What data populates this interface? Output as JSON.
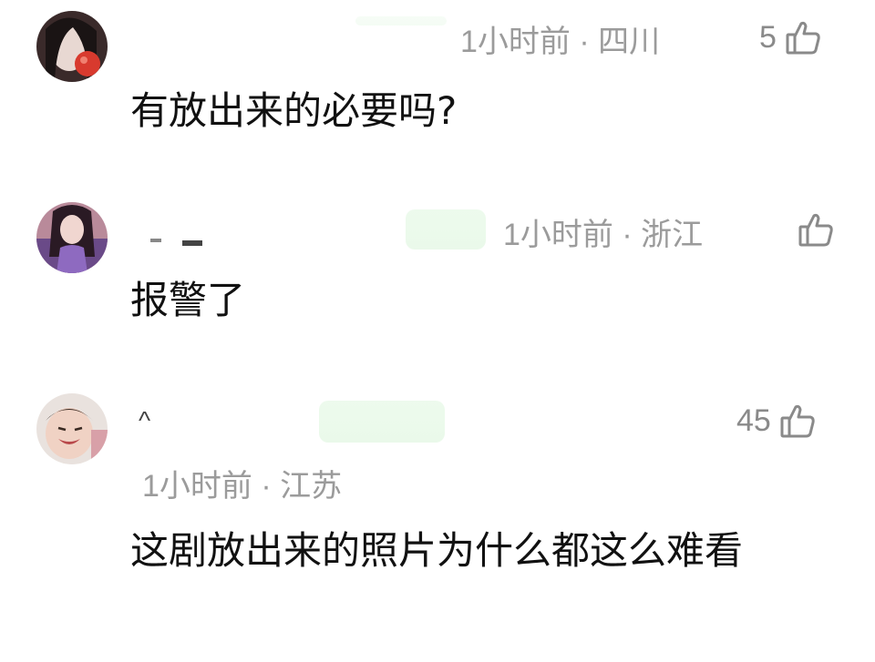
{
  "comments": [
    {
      "meta": "1小时前 · 四川",
      "likes": "5",
      "text": "有放出来的必要吗?"
    },
    {
      "meta": "1小时前 · 浙江",
      "likes": "",
      "text": "报警了"
    },
    {
      "meta": "1小时前 · 江苏",
      "likes": "45",
      "text": "这剧放出来的照片为什么都这么难看"
    }
  ],
  "icons": {
    "like": "thumbs-up-icon",
    "avatar": "avatar"
  },
  "colors": {
    "meta_gray": "#9b9b9b",
    "text": "#111111",
    "mask_green": "#e4f7e4"
  }
}
